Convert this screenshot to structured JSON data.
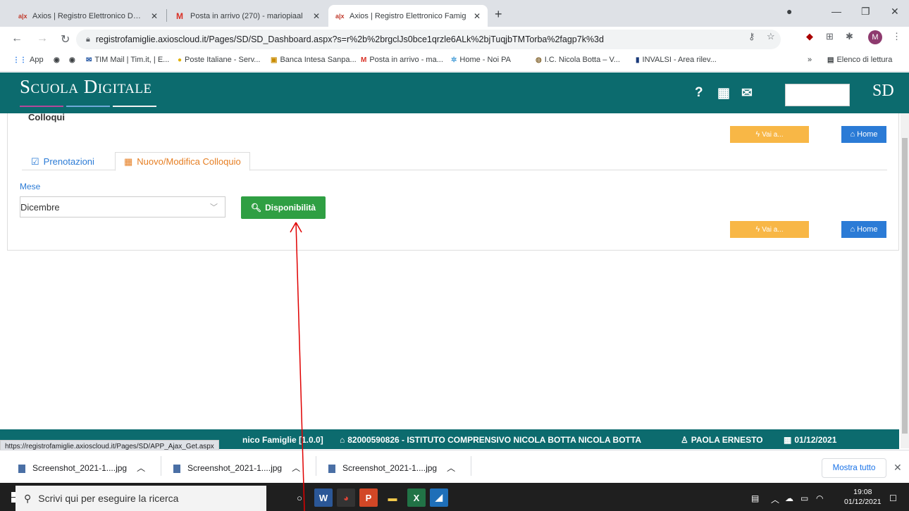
{
  "browser": {
    "tabs": [
      {
        "favicon": "axios",
        "title": "Axios | Registro Elettronico Docen",
        "active": false
      },
      {
        "favicon": "M",
        "title": "Posta in arrivo (270) - mariopiaal",
        "active": false
      },
      {
        "favicon": "axios",
        "title": "Axios | Registro Elettronico Famig",
        "active": true
      }
    ],
    "new_tab_label": "+",
    "url": "registrofamiglie.axioscloud.it/Pages/SD/SD_Dashboard.aspx?s=r%2b%2brgclJs0bce1qrzle6ALk%2bjTuqjbTMTorba%2fagp7k%3d",
    "profile_initial": "M",
    "bookmarks": [
      {
        "icon": "apps-icon",
        "label": "App"
      },
      {
        "icon": "globe-icon",
        "label": ""
      },
      {
        "icon": "globe-icon",
        "label": ""
      },
      {
        "icon": "mail-icon",
        "label": "TIM Mail | Tim.it, | E..."
      },
      {
        "icon": "pt-icon",
        "label": "Poste Italiane - Serv..."
      },
      {
        "icon": "bank-icon",
        "label": "Banca Intesa Sanpa..."
      },
      {
        "icon": "gmail-icon",
        "label": "Posta in arrivo - ma..."
      },
      {
        "icon": "noipa-icon",
        "label": "Home - Noi PA"
      },
      {
        "icon": "school-icon",
        "label": "I.C. Nicola Botta – V..."
      },
      {
        "icon": "invalsi-icon",
        "label": "INVALSI - Area rilev..."
      }
    ],
    "bookmarks_more": "»",
    "reading_list": "Elenco di lettura"
  },
  "app": {
    "brand": "Scuola Digitale",
    "brand_colors": [
      "#b5479a",
      "#6fa9d8",
      "#f2f2f2"
    ],
    "logo_text": "SD",
    "section_title": "Colloqui",
    "vai_label": "Vai a...",
    "home_label": "Home",
    "tabs": {
      "prenotazioni": "Prenotazioni",
      "nuovo": "Nuovo/Modifica Colloquio"
    },
    "mese_label": "Mese",
    "mese_value": "Dicembre",
    "disponibilita_label": "Disponibilità",
    "accent_color": "#0c6b6e"
  },
  "footer": {
    "app_name": "nico Famiglie [1.0.0]",
    "school": "82000590826 - ISTITUTO COMPRENSIVO NICOLA BOTTA NICOLA BOTTA",
    "user": "PAOLA ERNESTO",
    "date": "01/12/2021"
  },
  "status_url": "https://registrofamiglie.axioscloud.it/Pages/SD/APP_Ajax_Get.aspx",
  "downloads": {
    "items": [
      "Screenshot_2021-1....jpg",
      "Screenshot_2021-1....jpg",
      "Screenshot_2021-1....jpg"
    ],
    "show_all": "Mostra tutto"
  },
  "taskbar": {
    "search_placeholder": "Scrivi qui per eseguire la ricerca",
    "time": "19:08",
    "date": "01/12/2021"
  }
}
